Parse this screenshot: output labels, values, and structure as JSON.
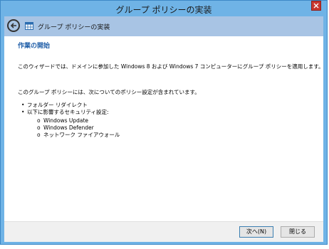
{
  "window": {
    "title": "グループ ポリシーの実装"
  },
  "header": {
    "title": "グループ ポリシーの実装"
  },
  "content": {
    "heading": "作業の開始",
    "description": "このウィザードでは、ドメインに参加した Windows 8 および Windows 7 コンピューターにグループ ポリシーを適用します。",
    "intro": "このグループ ポリシーには、次についてのポリシー設定が含まれています。",
    "bullets": [
      "フォルダー リダイレクト",
      "以下に影響するセキュリティ設定:"
    ],
    "sub_items": [
      "Windows Update",
      "Windows Defender",
      "ネットワーク ファイアウォール"
    ]
  },
  "footer": {
    "next_label": "次へ(N)",
    "close_label": "閉じる"
  },
  "colors": {
    "titlebar": "#6fb3e6",
    "header_band": "#a8c4e4",
    "heading": "#1f5ea8",
    "close_button": "#c7372f"
  }
}
